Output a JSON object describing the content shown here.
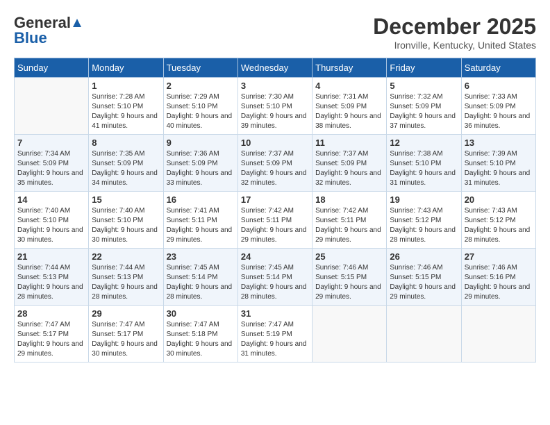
{
  "logo": {
    "part1": "General",
    "part2": "Blue"
  },
  "title": "December 2025",
  "subtitle": "Ironville, Kentucky, United States",
  "days_of_week": [
    "Sunday",
    "Monday",
    "Tuesday",
    "Wednesday",
    "Thursday",
    "Friday",
    "Saturday"
  ],
  "weeks": [
    [
      {
        "day": "",
        "sunrise": "",
        "sunset": "",
        "daylight": ""
      },
      {
        "day": "1",
        "sunrise": "Sunrise: 7:28 AM",
        "sunset": "Sunset: 5:10 PM",
        "daylight": "Daylight: 9 hours and 41 minutes."
      },
      {
        "day": "2",
        "sunrise": "Sunrise: 7:29 AM",
        "sunset": "Sunset: 5:10 PM",
        "daylight": "Daylight: 9 hours and 40 minutes."
      },
      {
        "day": "3",
        "sunrise": "Sunrise: 7:30 AM",
        "sunset": "Sunset: 5:10 PM",
        "daylight": "Daylight: 9 hours and 39 minutes."
      },
      {
        "day": "4",
        "sunrise": "Sunrise: 7:31 AM",
        "sunset": "Sunset: 5:09 PM",
        "daylight": "Daylight: 9 hours and 38 minutes."
      },
      {
        "day": "5",
        "sunrise": "Sunrise: 7:32 AM",
        "sunset": "Sunset: 5:09 PM",
        "daylight": "Daylight: 9 hours and 37 minutes."
      },
      {
        "day": "6",
        "sunrise": "Sunrise: 7:33 AM",
        "sunset": "Sunset: 5:09 PM",
        "daylight": "Daylight: 9 hours and 36 minutes."
      }
    ],
    [
      {
        "day": "7",
        "sunrise": "Sunrise: 7:34 AM",
        "sunset": "Sunset: 5:09 PM",
        "daylight": "Daylight: 9 hours and 35 minutes."
      },
      {
        "day": "8",
        "sunrise": "Sunrise: 7:35 AM",
        "sunset": "Sunset: 5:09 PM",
        "daylight": "Daylight: 9 hours and 34 minutes."
      },
      {
        "day": "9",
        "sunrise": "Sunrise: 7:36 AM",
        "sunset": "Sunset: 5:09 PM",
        "daylight": "Daylight: 9 hours and 33 minutes."
      },
      {
        "day": "10",
        "sunrise": "Sunrise: 7:37 AM",
        "sunset": "Sunset: 5:09 PM",
        "daylight": "Daylight: 9 hours and 32 minutes."
      },
      {
        "day": "11",
        "sunrise": "Sunrise: 7:37 AM",
        "sunset": "Sunset: 5:09 PM",
        "daylight": "Daylight: 9 hours and 32 minutes."
      },
      {
        "day": "12",
        "sunrise": "Sunrise: 7:38 AM",
        "sunset": "Sunset: 5:10 PM",
        "daylight": "Daylight: 9 hours and 31 minutes."
      },
      {
        "day": "13",
        "sunrise": "Sunrise: 7:39 AM",
        "sunset": "Sunset: 5:10 PM",
        "daylight": "Daylight: 9 hours and 31 minutes."
      }
    ],
    [
      {
        "day": "14",
        "sunrise": "Sunrise: 7:40 AM",
        "sunset": "Sunset: 5:10 PM",
        "daylight": "Daylight: 9 hours and 30 minutes."
      },
      {
        "day": "15",
        "sunrise": "Sunrise: 7:40 AM",
        "sunset": "Sunset: 5:10 PM",
        "daylight": "Daylight: 9 hours and 30 minutes."
      },
      {
        "day": "16",
        "sunrise": "Sunrise: 7:41 AM",
        "sunset": "Sunset: 5:11 PM",
        "daylight": "Daylight: 9 hours and 29 minutes."
      },
      {
        "day": "17",
        "sunrise": "Sunrise: 7:42 AM",
        "sunset": "Sunset: 5:11 PM",
        "daylight": "Daylight: 9 hours and 29 minutes."
      },
      {
        "day": "18",
        "sunrise": "Sunrise: 7:42 AM",
        "sunset": "Sunset: 5:11 PM",
        "daylight": "Daylight: 9 hours and 29 minutes."
      },
      {
        "day": "19",
        "sunrise": "Sunrise: 7:43 AM",
        "sunset": "Sunset: 5:12 PM",
        "daylight": "Daylight: 9 hours and 28 minutes."
      },
      {
        "day": "20",
        "sunrise": "Sunrise: 7:43 AM",
        "sunset": "Sunset: 5:12 PM",
        "daylight": "Daylight: 9 hours and 28 minutes."
      }
    ],
    [
      {
        "day": "21",
        "sunrise": "Sunrise: 7:44 AM",
        "sunset": "Sunset: 5:13 PM",
        "daylight": "Daylight: 9 hours and 28 minutes."
      },
      {
        "day": "22",
        "sunrise": "Sunrise: 7:44 AM",
        "sunset": "Sunset: 5:13 PM",
        "daylight": "Daylight: 9 hours and 28 minutes."
      },
      {
        "day": "23",
        "sunrise": "Sunrise: 7:45 AM",
        "sunset": "Sunset: 5:14 PM",
        "daylight": "Daylight: 9 hours and 28 minutes."
      },
      {
        "day": "24",
        "sunrise": "Sunrise: 7:45 AM",
        "sunset": "Sunset: 5:14 PM",
        "daylight": "Daylight: 9 hours and 28 minutes."
      },
      {
        "day": "25",
        "sunrise": "Sunrise: 7:46 AM",
        "sunset": "Sunset: 5:15 PM",
        "daylight": "Daylight: 9 hours and 29 minutes."
      },
      {
        "day": "26",
        "sunrise": "Sunrise: 7:46 AM",
        "sunset": "Sunset: 5:15 PM",
        "daylight": "Daylight: 9 hours and 29 minutes."
      },
      {
        "day": "27",
        "sunrise": "Sunrise: 7:46 AM",
        "sunset": "Sunset: 5:16 PM",
        "daylight": "Daylight: 9 hours and 29 minutes."
      }
    ],
    [
      {
        "day": "28",
        "sunrise": "Sunrise: 7:47 AM",
        "sunset": "Sunset: 5:17 PM",
        "daylight": "Daylight: 9 hours and 29 minutes."
      },
      {
        "day": "29",
        "sunrise": "Sunrise: 7:47 AM",
        "sunset": "Sunset: 5:17 PM",
        "daylight": "Daylight: 9 hours and 30 minutes."
      },
      {
        "day": "30",
        "sunrise": "Sunrise: 7:47 AM",
        "sunset": "Sunset: 5:18 PM",
        "daylight": "Daylight: 9 hours and 30 minutes."
      },
      {
        "day": "31",
        "sunrise": "Sunrise: 7:47 AM",
        "sunset": "Sunset: 5:19 PM",
        "daylight": "Daylight: 9 hours and 31 minutes."
      },
      {
        "day": "",
        "sunrise": "",
        "sunset": "",
        "daylight": ""
      },
      {
        "day": "",
        "sunrise": "",
        "sunset": "",
        "daylight": ""
      },
      {
        "day": "",
        "sunrise": "",
        "sunset": "",
        "daylight": ""
      }
    ]
  ]
}
